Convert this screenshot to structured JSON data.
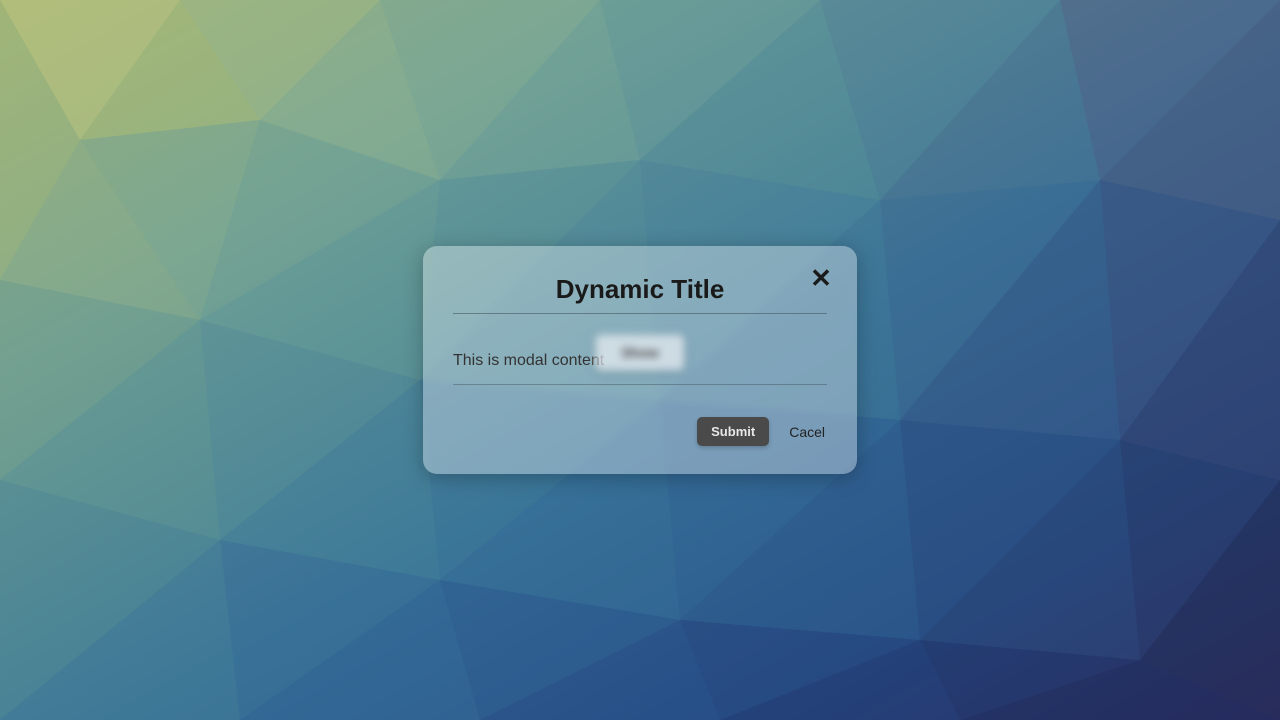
{
  "modal": {
    "title": "Dynamic Title",
    "content": "This is modal content",
    "blurred_button_label": "Show",
    "submit_label": "Submit",
    "cancel_label": "Cacel",
    "close_glyph": "✕"
  }
}
